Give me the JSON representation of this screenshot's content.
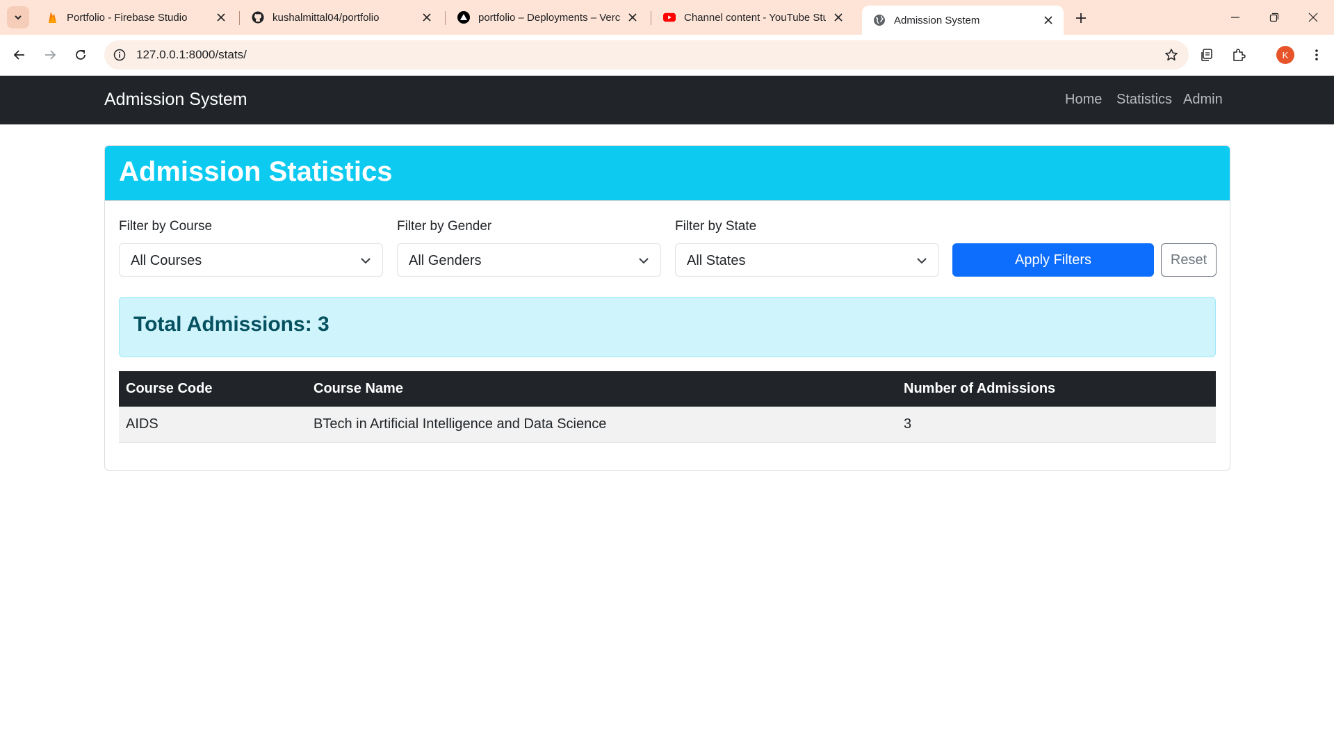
{
  "browser": {
    "tabs": [
      {
        "title": "Portfolio - Firebase Studio",
        "icon": "firebase-icon"
      },
      {
        "title": "kushalmittal04/portfolio",
        "icon": "github-icon"
      },
      {
        "title": "portfolio – Deployments – Vercel",
        "icon": "vercel-icon"
      },
      {
        "title": "Channel content - YouTube Studio",
        "icon": "youtube-icon"
      },
      {
        "title": "Admission System",
        "icon": "globe-icon",
        "active": true
      }
    ],
    "url": "127.0.0.1:8000/stats/",
    "profile_initial": "K"
  },
  "navbar": {
    "brand": "Admission System",
    "links": [
      "Home",
      "Statistics",
      "Admin"
    ]
  },
  "page": {
    "header": "Admission Statistics",
    "filters": {
      "course": {
        "label": "Filter by Course",
        "value": "All Courses"
      },
      "gender": {
        "label": "Filter by Gender",
        "value": "All Genders"
      },
      "state": {
        "label": "Filter by State",
        "value": "All States"
      },
      "apply_label": "Apply Filters",
      "reset_label": "Reset"
    },
    "total": "Total Admissions: 3",
    "table": {
      "headers": [
        "Course Code",
        "Course Name",
        "Number of Admissions"
      ],
      "rows": [
        [
          "AIDS",
          "BTech in Artificial Intelligence and Data Science",
          "3"
        ]
      ]
    }
  },
  "colors": {
    "navbar": "#212529",
    "header": "#0dcaf0",
    "primary": "#0d6efd",
    "alert_bg": "#cff4fc",
    "alert_text": "#055160"
  }
}
